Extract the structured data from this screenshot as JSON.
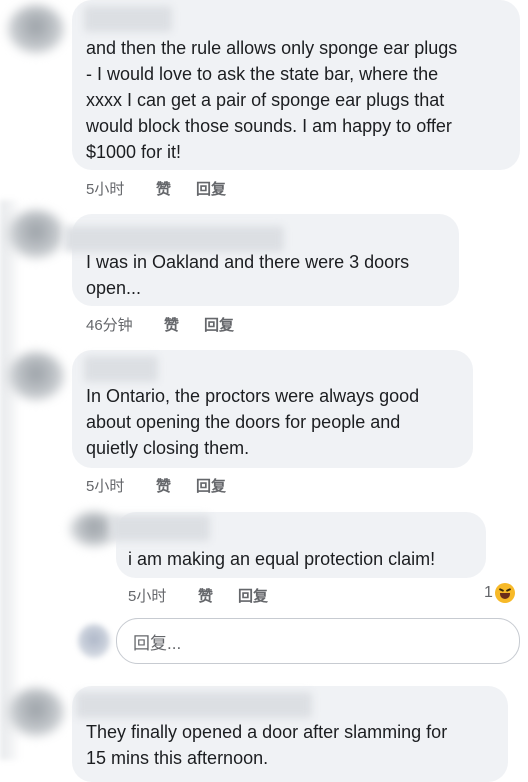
{
  "comments": [
    {
      "text": "and then the rule allows only sponge ear plugs\n- I would love to ask the state bar, where the\nxxxx I can get a pair of sponge ear plugs that\nwould block those sounds.  I am happy to offer\n$1000 for it!",
      "time": "5小时",
      "like": "赞",
      "reply": "回复"
    },
    {
      "text": "I was in Oakland and there were 3 doors\nopen...",
      "time": "46分钟",
      "like": "赞",
      "reply": "回复"
    },
    {
      "text": "In Ontario, the proctors were always good\nabout opening the doors for people and\nquietly closing them.",
      "time": "5小时",
      "like": "赞",
      "reply": "回复"
    },
    {
      "text": "i am making an equal protection claim!",
      "time": "5小时",
      "like": "赞",
      "reply": "回复",
      "reaction_count": "1",
      "reaction_icon": "laughing-emoji-icon"
    },
    {
      "text": "They finally opened a door after slamming for\n15 mins this afternoon."
    }
  ],
  "reply_box": {
    "placeholder": "回复..."
  },
  "colors": {
    "bubble": "#f0f2f5",
    "meta_text": "#65676b",
    "body_text": "#1c1e21",
    "emoji": "#f7b928"
  }
}
